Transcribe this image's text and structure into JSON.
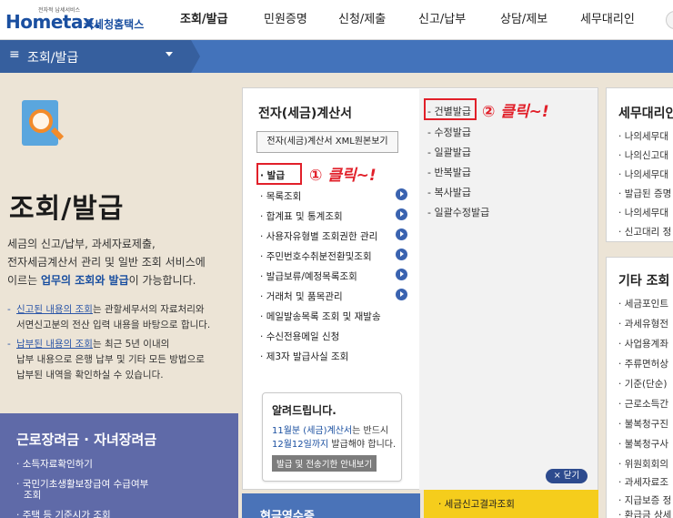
{
  "header": {
    "logo_tiny": "전자적 납세서비스",
    "logo_main": "Hometax.",
    "logo_kr": "국세청홈택스",
    "nav": [
      {
        "label": "조회/발급",
        "active": true
      },
      {
        "label": "민원증명",
        "active": false
      },
      {
        "label": "신청/제출",
        "active": false
      },
      {
        "label": "신고/납부",
        "active": false
      },
      {
        "label": "상담/제보",
        "active": false
      },
      {
        "label": "세무대리인",
        "active": false
      }
    ]
  },
  "menubar": {
    "label": "조회/발급"
  },
  "left": {
    "title": "조회/발급",
    "desc_1": "세금의 신고/납부, 과세자료제출,",
    "desc_2": "전자세금계산서 관리 및 일반 조회 서비스에",
    "desc_3_pre": "이르는 ",
    "desc_3_hl": "업무의 조회와 발급",
    "desc_3_post": "이 가능합니다.",
    "note1_b": "신고된 내용의 조회",
    "note1_post": "는 관할세무서의 자료처리와",
    "note1_2": "서면신고분의 전산 입력 내용을 바탕으로 합니다.",
    "note2_b": "납부된 내용의 조회",
    "note2_post": "는 최근 5년 이내의",
    "note2_2": "납부 내용으로 은행 납부 및 기타 모든 방법으로",
    "note2_3": "납부된 내역을 확인하실 수 있습니다.",
    "box": {
      "title": "근로장려금 · 자녀장려금",
      "items": [
        "소득자료확인하기",
        "국민기초생활보장급여 수급여부",
        "조회",
        "주택 등 기준시가 조회"
      ]
    }
  },
  "menu": {
    "title": "전자(세금)계산서",
    "xml_button": "전자(세금)계산서 XML원본보기",
    "items": [
      "발급",
      "목록조회",
      "합계표 및 통계조회",
      "사용자유형별 조회권한 관리",
      "주민번호수취분전환및조회",
      "발급보류/예정목록조회",
      "거래처 및 품목관리",
      "메일발송목록 조회 및 재발송",
      "수신전용메일 신청",
      "제3자 발급사실 조회"
    ],
    "sub_items": [
      "건별발급",
      "수정발급",
      "일괄발급",
      "반복발급",
      "복사발급",
      "일괄수정발급"
    ],
    "annotation_1": "① 클릭~!",
    "annotation_2": "② 클릭~!",
    "notice": {
      "title": "알려드립니다.",
      "line1_blue": "11월분 (세금)계산서",
      "line1_post": "는 반드시",
      "line2_blue": "12월12일까지",
      "line2_post": " 발급해야 합니다.",
      "button": "발급 및 전송기한 안내보기"
    },
    "close_button": "× 닫기",
    "bottom_yellow": "· 세금신고결과조회",
    "bottom_blue": "현금영수증"
  },
  "right": {
    "box1_title": "세무대리인",
    "box1_items": [
      "나의세무대",
      "나의신고대",
      "나의세무대",
      "발급된 증명",
      "나의세무대",
      "신고대리 정"
    ],
    "box2_title": "기타 조회",
    "box2_items": [
      "세금포인트",
      "과세유형전",
      "사업용계좌",
      "주류면허상",
      "기준(단순)",
      "근로소득간",
      "불복청구진",
      "불복청구사",
      "위원회회의",
      "과세자료조",
      "지급보증 정",
      "환급금 상세"
    ]
  },
  "colors": {
    "accent": "#4373bb",
    "highlight": "#e1202a",
    "yellow": "#f5cd1c"
  }
}
